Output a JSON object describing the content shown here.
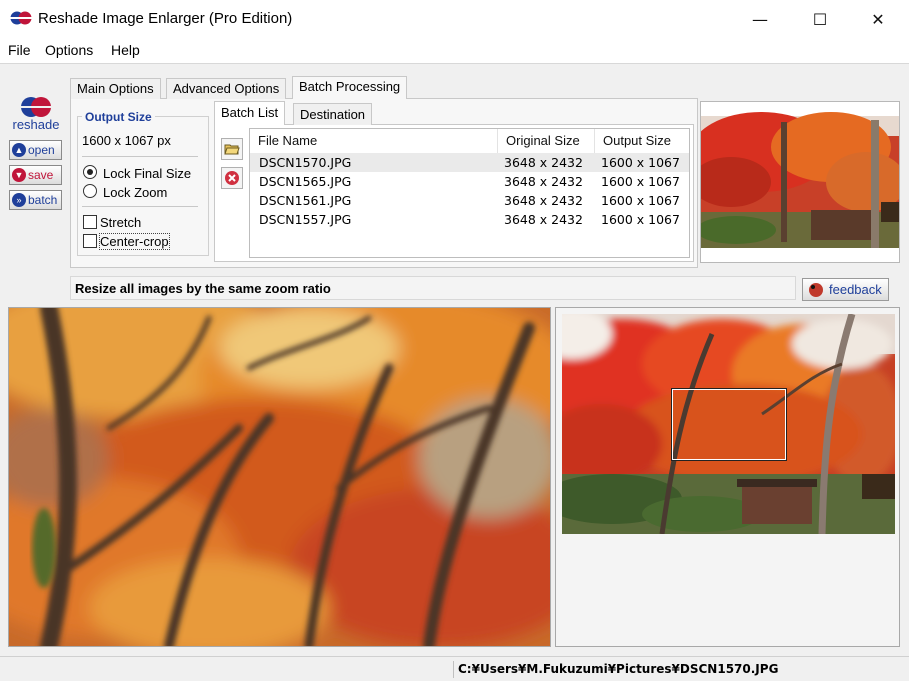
{
  "window": {
    "title": "Reshade Image Enlarger (Pro Edition)",
    "minimize_glyph": "—",
    "maximize_glyph": "☐",
    "close_glyph": "✕"
  },
  "menu": {
    "file": "File",
    "options": "Options",
    "help": "Help"
  },
  "sidebar": {
    "logo_text": "reshade",
    "open_label": "open",
    "save_label": "save",
    "batch_label": "batch"
  },
  "tabs": [
    {
      "label": "Main Options",
      "active": false
    },
    {
      "label": "Advanced Options",
      "active": false
    },
    {
      "label": "Batch Processing",
      "active": true
    }
  ],
  "output_size": {
    "title": "Output Size",
    "value": "1600 x 1067 px",
    "lock_final_size": "Lock Final Size",
    "lock_zoom": "Lock Zoom",
    "stretch": "Stretch",
    "center_crop": "Center-crop",
    "selected_lock": "Lock Final Size"
  },
  "batch": {
    "subtabs": [
      "Batch List",
      "Destination"
    ],
    "columns": [
      "File Name",
      "Original Size",
      "Output Size"
    ],
    "rows": [
      {
        "name": "DSCN1570.JPG",
        "original": "3648 x 2432",
        "output": "1600 x 1067",
        "selected": true
      },
      {
        "name": "DSCN1565.JPG",
        "original": "3648 x 2432",
        "output": "1600 x 1067",
        "selected": false
      },
      {
        "name": "DSCN1561.JPG",
        "original": "3648 x 2432",
        "output": "1600 x 1067",
        "selected": false
      },
      {
        "name": "DSCN1557.JPG",
        "original": "3648 x 2432",
        "output": "1600 x 1067",
        "selected": false
      }
    ]
  },
  "info_text": "Resize all images by the same zoom ratio",
  "feedback_label": "feedback",
  "status_path": "C:¥Users¥M.Fukuzumi¥Pictures¥DSCN1570.JPG",
  "colors": {
    "brand_blue": "#1f3f9a",
    "brand_red": "#c0153a",
    "foliage_red": "#d8381c",
    "foliage_orange": "#e8741e"
  },
  "icons": [
    "app-logo-icon",
    "open-folder-icon",
    "delete-icon",
    "ladybug-icon"
  ]
}
